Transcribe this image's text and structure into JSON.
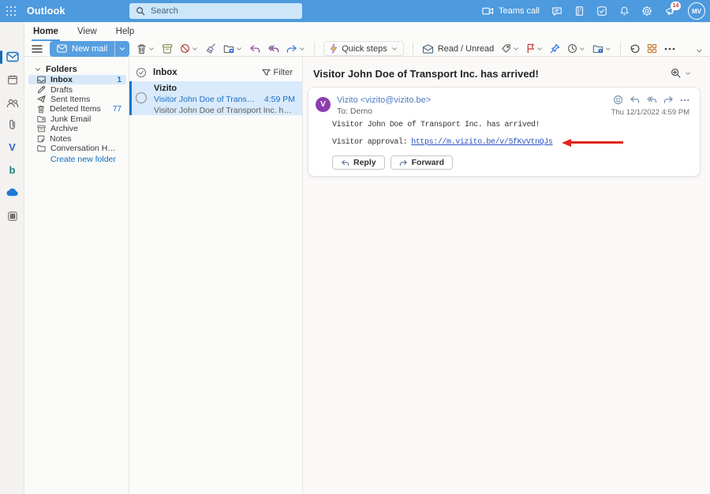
{
  "topbar": {
    "brand": "Outlook",
    "search_placeholder": "Search",
    "teams_call_label": "Teams call",
    "badge_count": "14",
    "avatar_initials": "MV"
  },
  "ribbon": {
    "tabs": [
      {
        "label": "Home"
      },
      {
        "label": "View"
      },
      {
        "label": "Help"
      }
    ],
    "active_tab": "Home",
    "new_mail_label": "New mail",
    "quick_steps_label": "Quick steps",
    "read_unread_label": "Read / Unread"
  },
  "folders": {
    "header": "Folders",
    "items": [
      {
        "label": "Inbox",
        "count": "1"
      },
      {
        "label": "Drafts",
        "count": ""
      },
      {
        "label": "Sent Items",
        "count": ""
      },
      {
        "label": "Deleted Items",
        "count": "77"
      },
      {
        "label": "Junk Email",
        "count": ""
      },
      {
        "label": "Archive",
        "count": ""
      },
      {
        "label": "Notes",
        "count": ""
      },
      {
        "label": "Conversation His...",
        "count": ""
      }
    ],
    "create_link": "Create new folder"
  },
  "list": {
    "header": "Inbox",
    "filter_label": "Filter",
    "items": [
      {
        "sender": "Vizito",
        "subject": "Visitor John Doe of Transport Inc. ...",
        "time": "4:59 PM",
        "preview": "Visitor John Doe of Transport Inc. has arrived! ..."
      }
    ]
  },
  "reading": {
    "title": "Visitor John Doe of Transport Inc. has arrived!",
    "sender": "Vizito <vizito@vizito.be>",
    "avatar_letter": "V",
    "to_line": "To: Demo",
    "timestamp": "Thu 12/1/2022 4:59 PM",
    "body_line1": "Visitor John Doe of Transport Inc. has arrived!",
    "approval_label": "Visitor approval:",
    "approval_link": "https://m.vizito.be/v/5fKvVtnQJs",
    "reply_label": "Reply",
    "forward_label": "Forward"
  },
  "icons": {
    "topbar": [
      "app-launcher",
      "search",
      "video-camera",
      "chat",
      "notebook",
      "tasks-check",
      "bell",
      "settings-gear",
      "feedback-megaphone"
    ],
    "rail": [
      "mail",
      "calendar",
      "people",
      "attachments",
      "viva-engage",
      "bookings",
      "onedrive",
      "more-apps"
    ],
    "toolbar": [
      "menu",
      "new-mail-envelope",
      "delete",
      "archive",
      "block",
      "sweep",
      "move-to-folder",
      "reply",
      "reply-all",
      "forward",
      "quick-steps-bolt",
      "read-unread-envelope",
      "tag",
      "flag",
      "pin",
      "schedule-clock",
      "snooze-folder",
      "undo",
      "apps",
      "more-options"
    ],
    "message_card": [
      "emoji-react",
      "reply",
      "reply-all",
      "forward",
      "more-options"
    ],
    "annotation": [
      "red-arrow-left"
    ]
  },
  "colors": {
    "topbar_blue": "#4d9ade",
    "accent_blue": "#1374d4",
    "selection_bg": "#d8eafb",
    "count_blue": "#1b6ec2",
    "link_blue": "#2b52c4",
    "arrow_red": "#e0241b",
    "avatar_purple": "#8d3daf"
  }
}
